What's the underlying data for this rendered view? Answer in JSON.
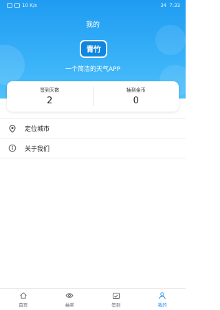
{
  "status_bar": {
    "left": "10 K/s",
    "right": "7:33",
    "battery": "34"
  },
  "header": {
    "title": "我的",
    "logo_text": "青竹",
    "slogan": "一个简洁的天气APP"
  },
  "stats": [
    {
      "label": "签到天数",
      "value": "2"
    },
    {
      "label": "抽到金币",
      "value": "0"
    }
  ],
  "menu": [
    {
      "label": "定位城市",
      "icon": "location-pin-icon"
    },
    {
      "label": "关于我们",
      "icon": "info-icon"
    }
  ],
  "tabs": [
    {
      "label": "首页",
      "icon": "home-icon",
      "active": false
    },
    {
      "label": "抽奖",
      "icon": "eye-icon",
      "active": false
    },
    {
      "label": "签到",
      "icon": "calendar-check-icon",
      "active": false
    },
    {
      "label": "我的",
      "icon": "user-icon",
      "active": true
    }
  ],
  "colors": {
    "header_top": "#1f9cf2",
    "header_bottom": "#4fc0fb",
    "active_tab": "#2a8cf0"
  }
}
